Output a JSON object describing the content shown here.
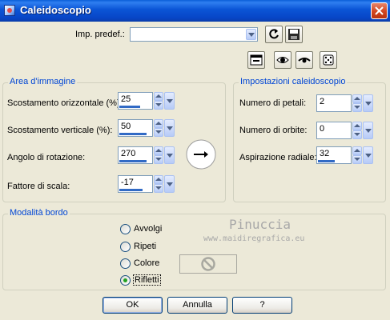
{
  "window": {
    "title": "Caleidoscopio"
  },
  "preset": {
    "label": "Imp. predef.:",
    "value": ""
  },
  "area": {
    "title": "Area d'immagine",
    "fields": [
      {
        "label": "Scostamento orizzontale (%):",
        "value": "25",
        "fill": 0.62
      },
      {
        "label": "Scostamento verticale (%):",
        "value": "50",
        "fill": 0.8
      },
      {
        "label": "Angolo di rotazione:",
        "value": "270",
        "fill": 0.8
      },
      {
        "label": "Fattore di scala:",
        "value": "-17",
        "fill": 0.4
      }
    ]
  },
  "settings": {
    "title": "Impostazioni caleidoscopio",
    "fields": [
      {
        "label": "Numero di petali:",
        "value": "2",
        "fill": 0.0
      },
      {
        "label": "Numero di orbite:",
        "value": "0",
        "fill": 0.0
      },
      {
        "label": "Aspirazione radiale:",
        "value": "32",
        "fill": 0.35
      }
    ]
  },
  "edge": {
    "title": "Modalità bordo",
    "options": [
      {
        "label": "Avvolgi",
        "checked": false
      },
      {
        "label": "Ripeti",
        "checked": false
      },
      {
        "label": "Colore",
        "checked": false
      },
      {
        "label": "Rifletti",
        "checked": true
      }
    ]
  },
  "watermark": {
    "line1": "Pinuccia",
    "line2": "www.maidiregrafica.eu"
  },
  "buttons": {
    "ok": "OK",
    "cancel": "Annulla",
    "help": "?"
  },
  "icons": [
    "app-icon",
    "close-icon",
    "reset-icon",
    "save-icon",
    "preview-icon",
    "eye-icon",
    "eye-closed-icon",
    "dice-icon",
    "rotation-dial-icon",
    "color-none-icon"
  ]
}
